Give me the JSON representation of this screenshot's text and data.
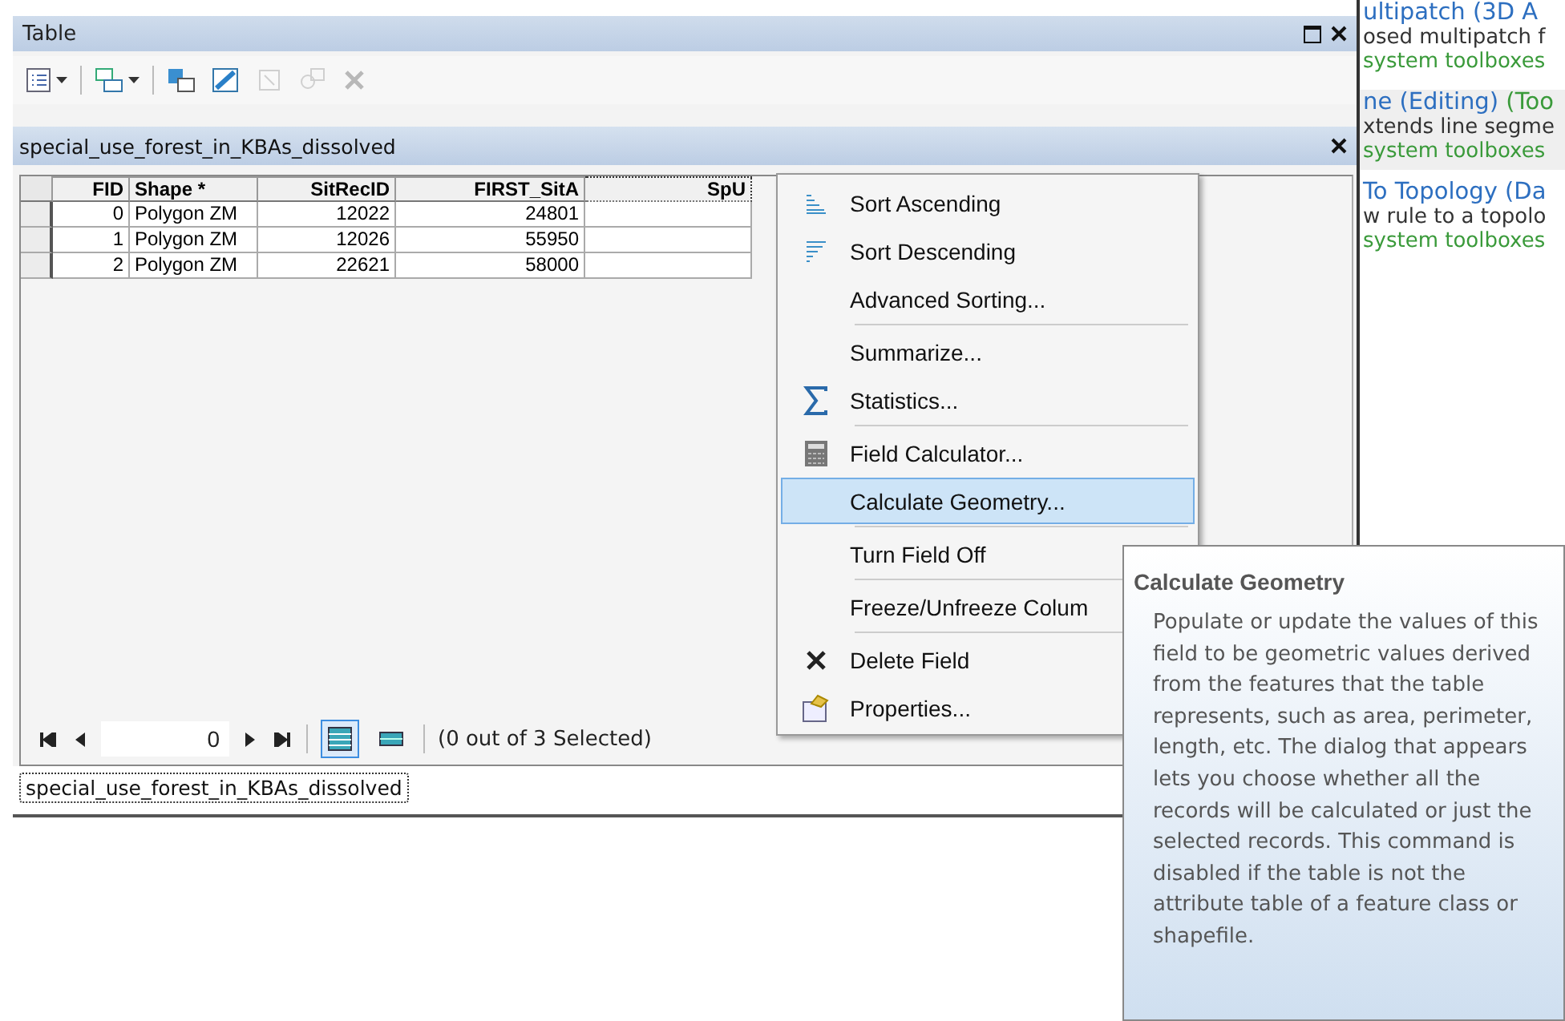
{
  "window": {
    "title": "Table"
  },
  "toolbar": [
    {
      "disabled": false
    },
    {
      "disabled": false
    },
    {
      "disabled": false
    },
    {
      "disabled": false
    },
    {
      "disabled": true
    },
    {
      "disabled": true
    },
    {
      "disabled": true
    }
  ],
  "table_title": "special_use_forest_in_KBAs_dissolved",
  "table": {
    "columns": [
      {
        "label": "FID",
        "selected": false
      },
      {
        "label": "Shape *",
        "selected": false
      },
      {
        "label": "SitRecID",
        "selected": false
      },
      {
        "label": "FIRST_SitA",
        "selected": false
      },
      {
        "label": "SpU",
        "selected": true
      }
    ],
    "rows": [
      [
        "0",
        "Polygon ZM",
        "12022",
        "24801",
        ""
      ],
      [
        "1",
        "Polygon ZM",
        "12026",
        "55950",
        ""
      ],
      [
        "2",
        "Polygon ZM",
        "22621",
        "58000",
        ""
      ]
    ]
  },
  "navigation": {
    "record": "0",
    "views": [
      {
        "selected": true
      },
      {
        "selected": false
      }
    ],
    "status": "(0 out of 3 Selected)"
  },
  "tabs": [
    {
      "label": "special_use_forest_in_KBAs_dissolved",
      "selected": true
    }
  ],
  "context_menu": [
    {
      "kind": "item",
      "label": "Sort Ascending",
      "selected": false
    },
    {
      "kind": "item",
      "label": "Sort Descending",
      "selected": false
    },
    {
      "kind": "item",
      "label": "Advanced Sorting...",
      "selected": false
    },
    {
      "kind": "separator"
    },
    {
      "kind": "item",
      "label": "Summarize...",
      "selected": false
    },
    {
      "kind": "item",
      "label": "Statistics...",
      "selected": false
    },
    {
      "kind": "separator"
    },
    {
      "kind": "item",
      "label": "Field Calculator...",
      "selected": false
    },
    {
      "kind": "item",
      "label": "Calculate Geometry...",
      "selected": true
    },
    {
      "kind": "separator"
    },
    {
      "kind": "item",
      "label": "Turn Field Off",
      "selected": false
    },
    {
      "kind": "separator"
    },
    {
      "kind": "item",
      "label": "Freeze/Unfreeze Colum",
      "selected": false
    },
    {
      "kind": "separator"
    },
    {
      "kind": "item",
      "label": "Delete Field",
      "selected": false
    },
    {
      "kind": "item",
      "label": "Properties...",
      "selected": false
    }
  ],
  "tooltip": {
    "title": "Calculate Geometry",
    "text": "Populate or update the values of this field to be geometric values derived from the features that the table represents, such as area, perimeter, length, etc. The dialog that appears lets you choose whether all the records will be calculated or just the selected records. This command is disabled if the table is not the attribute table of a feature class or shapefile."
  },
  "search_results": [
    {
      "title": "ultipatch (3D A",
      "description": "osed multipatch f",
      "source": "system toolboxes",
      "selected": false
    },
    {
      "title": "ne (Editing)",
      "toolbox": " (Too",
      "description": "xtends line segme",
      "source": "system toolboxes",
      "selected": true
    },
    {
      "title": "To Topology (Da",
      "description": "w rule to a topolo",
      "source": "system toolboxes",
      "selected": false
    }
  ]
}
